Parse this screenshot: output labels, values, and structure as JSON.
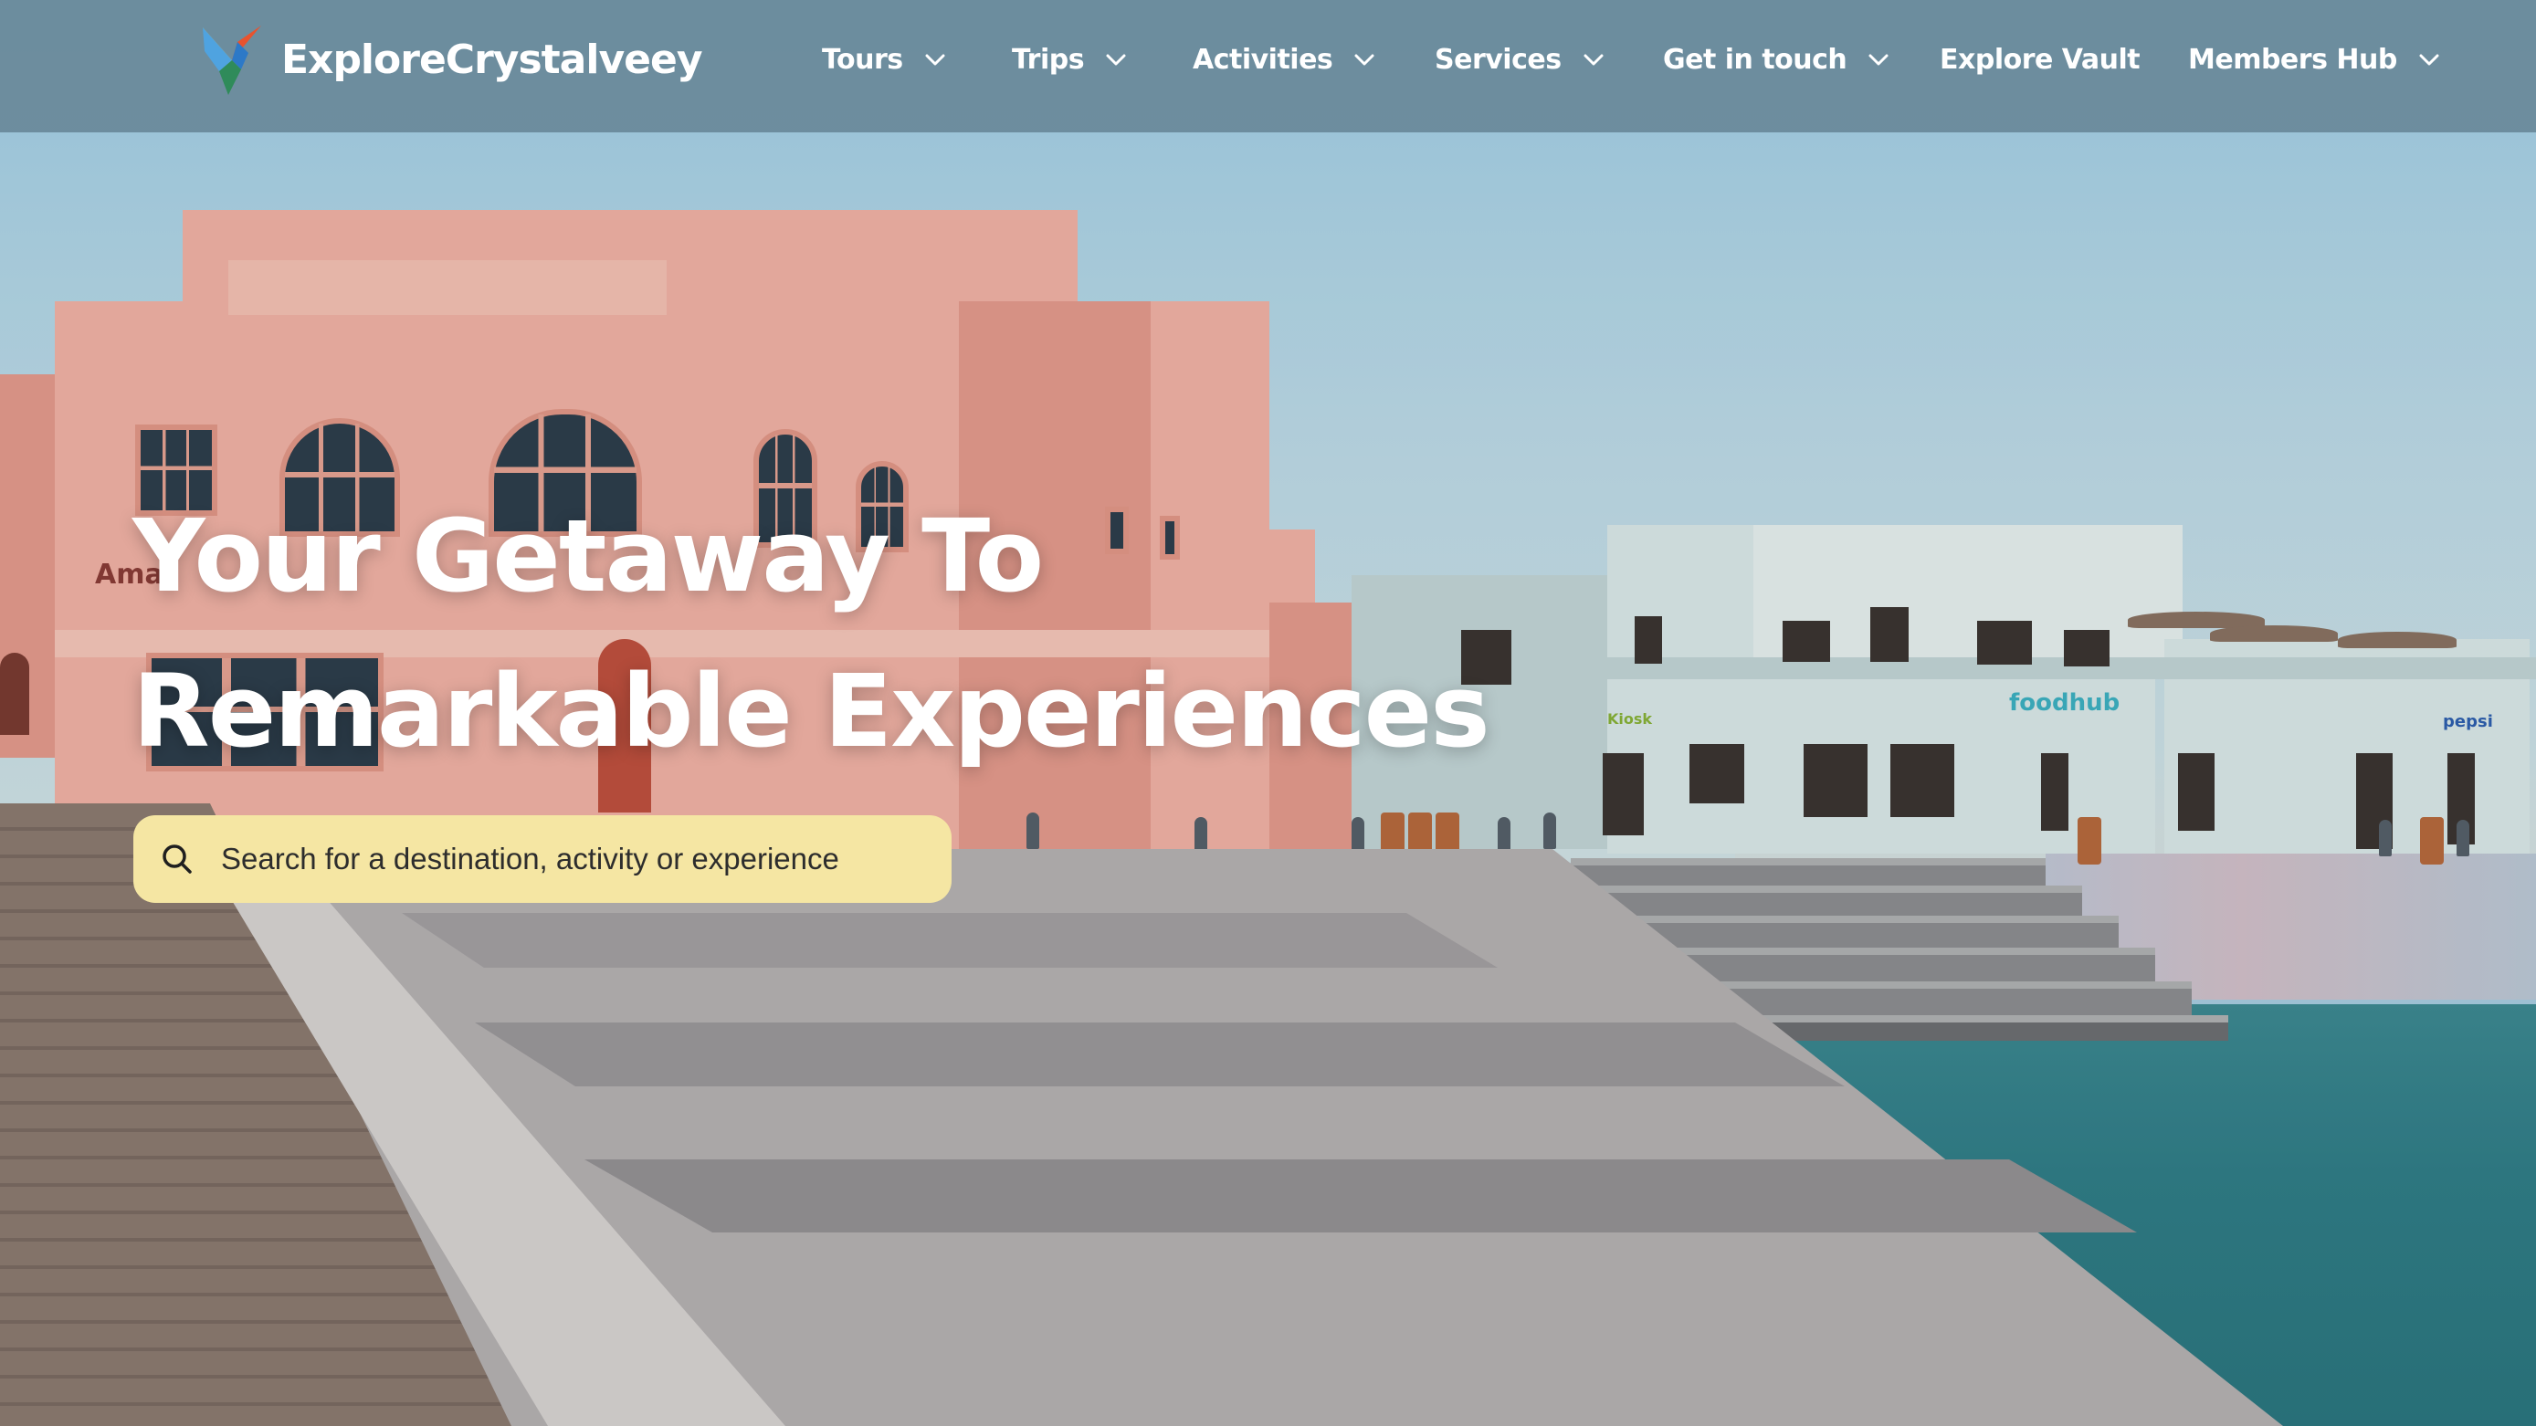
{
  "brand": {
    "name": "ExploreCrystalveey",
    "logo_icon": "bird-logo-icon"
  },
  "nav": {
    "items": [
      {
        "label": "Tours",
        "has_dropdown": true
      },
      {
        "label": "Trips",
        "has_dropdown": true
      },
      {
        "label": "Activities",
        "has_dropdown": true
      },
      {
        "label": "Services",
        "has_dropdown": true
      },
      {
        "label": "Get in touch",
        "has_dropdown": true
      },
      {
        "label": "Explore Vault",
        "has_dropdown": false
      },
      {
        "label": "Members Hub",
        "has_dropdown": true
      }
    ]
  },
  "hero": {
    "headline_line1": "Your Getaway To",
    "headline_line2": "Remarkable Experiences",
    "image_signs": {
      "left_building": "Ama",
      "foodhub": "foodhub",
      "kiosk": "Kiosk",
      "pepsi": "pepsi"
    }
  },
  "search": {
    "placeholder": "Search for a destination, activity or experience",
    "icon": "search-icon"
  },
  "colors": {
    "nav_background": "#6d8799",
    "search_background": "#f5e6a3",
    "headline_text": "#ffffff"
  }
}
